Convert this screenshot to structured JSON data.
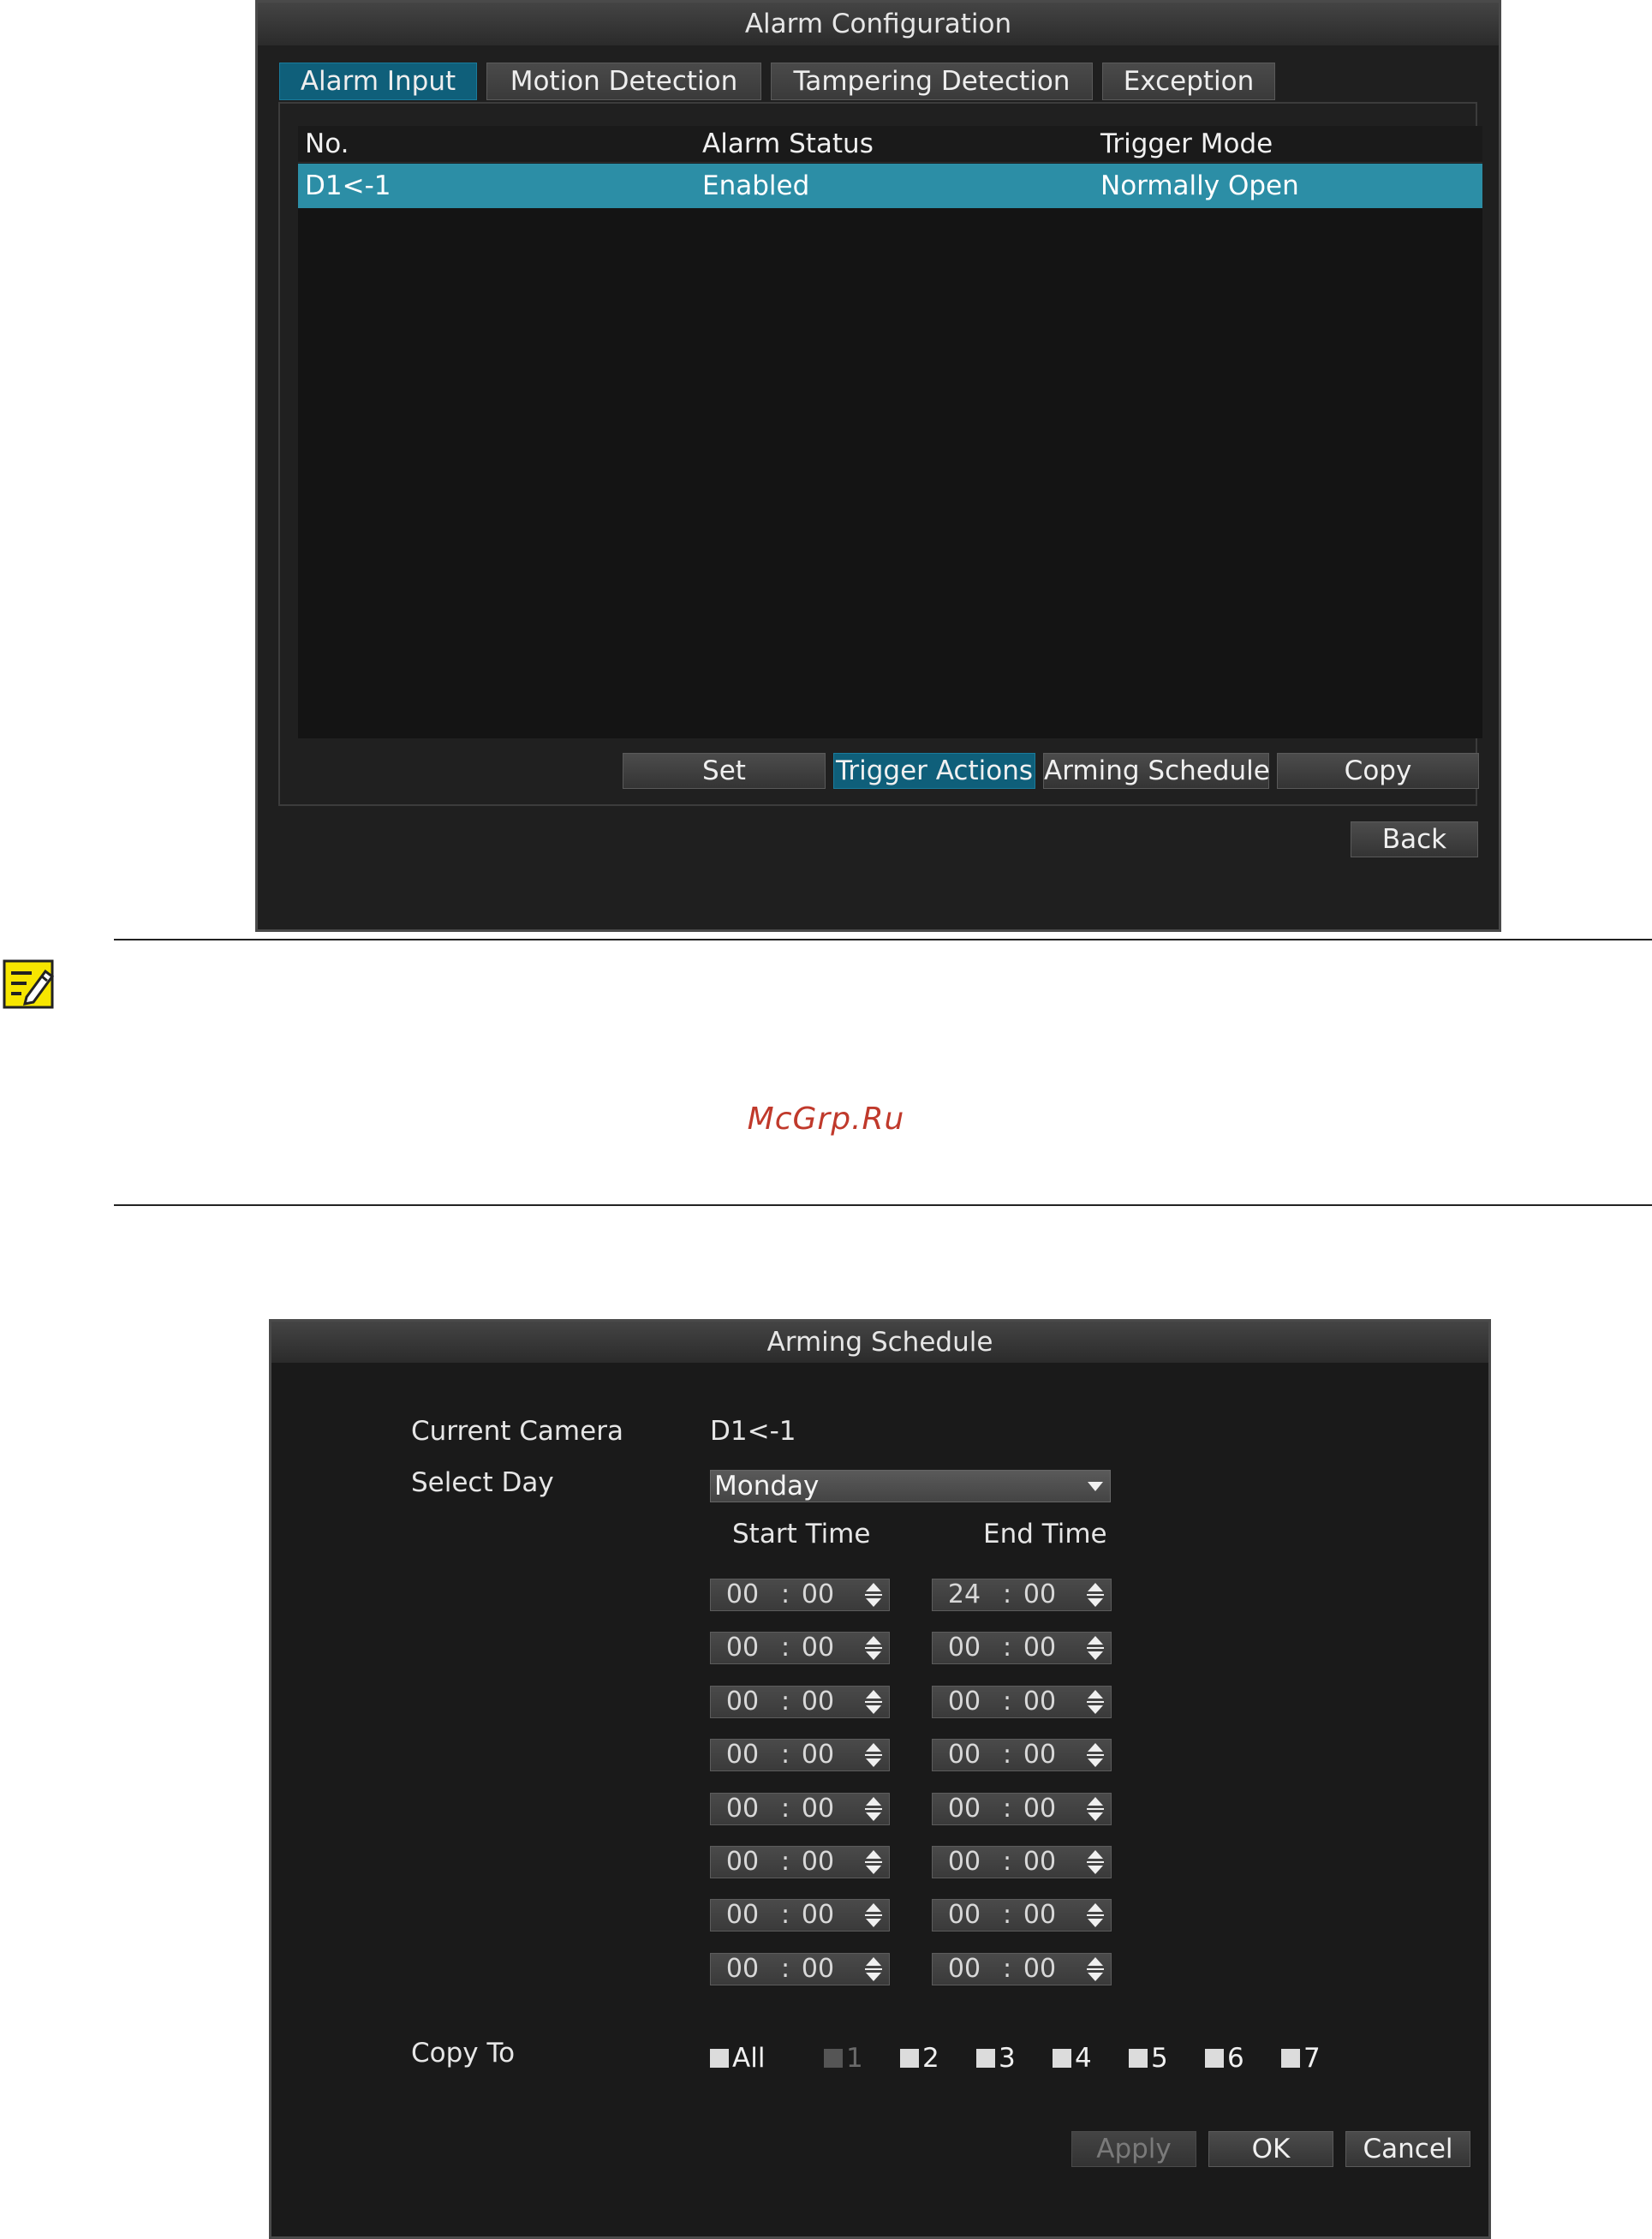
{
  "alarm_config": {
    "title": "Alarm Configuration",
    "tabs": [
      {
        "label": "Alarm Input",
        "active": true
      },
      {
        "label": "Motion Detection",
        "active": false
      },
      {
        "label": "Tampering Detection",
        "active": false
      },
      {
        "label": "Exception",
        "active": false
      }
    ],
    "table": {
      "columns": [
        "No.",
        "Alarm Status",
        "Trigger Mode"
      ],
      "rows": [
        {
          "no": "D1<-1",
          "status": "Enabled",
          "mode": "Normally Open",
          "selected": true
        }
      ]
    },
    "actions": [
      "Set",
      "Trigger Actions",
      "Arming Schedule",
      "Copy"
    ],
    "back_label": "Back"
  },
  "note": {
    "icon": "note-pencil-icon",
    "watermark": "McGrp.Ru"
  },
  "arming_schedule": {
    "title": "Arming Schedule",
    "current_camera_label": "Current Camera",
    "current_camera_value": "D1<-1",
    "select_day_label": "Select Day",
    "select_day_value": "Monday",
    "start_time_label": "Start Time",
    "end_time_label": "End Time",
    "periods": [
      {
        "start": [
          "00",
          "00"
        ],
        "end": [
          "24",
          "00"
        ]
      },
      {
        "start": [
          "00",
          "00"
        ],
        "end": [
          "00",
          "00"
        ]
      },
      {
        "start": [
          "00",
          "00"
        ],
        "end": [
          "00",
          "00"
        ]
      },
      {
        "start": [
          "00",
          "00"
        ],
        "end": [
          "00",
          "00"
        ]
      },
      {
        "start": [
          "00",
          "00"
        ],
        "end": [
          "00",
          "00"
        ]
      },
      {
        "start": [
          "00",
          "00"
        ],
        "end": [
          "00",
          "00"
        ]
      },
      {
        "start": [
          "00",
          "00"
        ],
        "end": [
          "00",
          "00"
        ]
      },
      {
        "start": [
          "00",
          "00"
        ],
        "end": [
          "00",
          "00"
        ]
      }
    ],
    "copy_to_label": "Copy To",
    "copy_to_options": [
      {
        "label": "All",
        "disabled": false
      },
      {
        "label": "1",
        "disabled": true
      },
      {
        "label": "2",
        "disabled": false
      },
      {
        "label": "3",
        "disabled": false
      },
      {
        "label": "4",
        "disabled": false
      },
      {
        "label": "5",
        "disabled": false
      },
      {
        "label": "6",
        "disabled": false
      },
      {
        "label": "7",
        "disabled": false
      }
    ],
    "apply_label": "Apply",
    "ok_label": "OK",
    "cancel_label": "Cancel"
  },
  "colors": {
    "accent": "#0f5f7a",
    "selected_row": "#2c8ea6",
    "window_bg": "#1f1f1f",
    "watermark": "#c0392b"
  }
}
